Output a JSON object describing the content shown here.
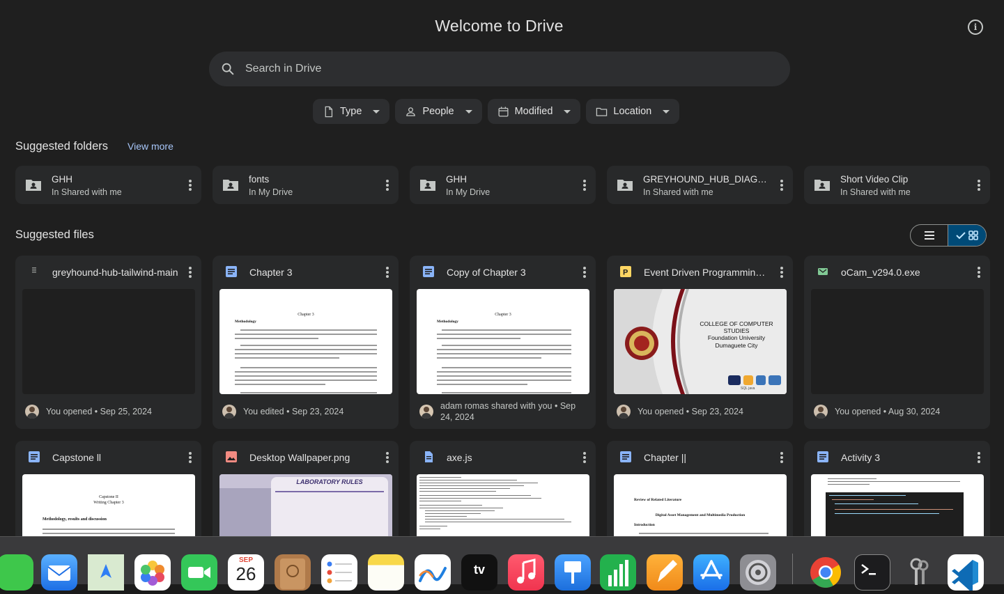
{
  "app": {
    "title": "Welcome to Drive",
    "info_icon": "info-icon"
  },
  "search": {
    "placeholder": "Search in Drive"
  },
  "filters": [
    {
      "label": "Type",
      "icon": "file-icon"
    },
    {
      "label": "People",
      "icon": "person-icon"
    },
    {
      "label": "Modified",
      "icon": "calendar-icon"
    },
    {
      "label": "Location",
      "icon": "folder-icon"
    }
  ],
  "suggested_folders": {
    "heading": "Suggested folders",
    "view_more": "View more",
    "items": [
      {
        "name": "GHH",
        "location": "In Shared with me"
      },
      {
        "name": "fonts",
        "location": "In My Drive"
      },
      {
        "name": "GHH",
        "location": "In My Drive"
      },
      {
        "name": "GREYHOUND_HUB_DIAGRAMS",
        "location": "In Shared with me"
      },
      {
        "name": "Short Video Clip",
        "location": "In Shared with me"
      }
    ]
  },
  "suggested_files": {
    "heading": "Suggested files",
    "items": [
      {
        "name": "greyhound-hub-tailwind-main",
        "activity": "You opened • Sep 25, 2024",
        "icon": "zip-icon",
        "icon_color": "#8e918f"
      },
      {
        "name": "Chapter 3",
        "activity": "You edited • Sep 23, 2024",
        "icon": "docs-icon",
        "icon_color": "#8ab4f8",
        "doc_title": "Chapter 3",
        "doc_sub": "Methodology"
      },
      {
        "name": "Copy of Chapter 3",
        "activity": "adam romas shared with you • Sep 24, 2024",
        "icon": "docs-icon",
        "icon_color": "#8ab4f8",
        "doc_title": "Chapter 3",
        "doc_sub": "Methodology"
      },
      {
        "name": "Event Driven Programming.pptx",
        "activity": "You opened • Sep 23, 2024",
        "icon": "slides-icon",
        "icon_color": "#fdd663",
        "slide_line1": "COLLEGE OF COMPUTER STUDIES",
        "slide_line2": "Foundation University",
        "slide_line3": "Dumaguete City",
        "slide_tags": "SQL java"
      },
      {
        "name": "oCam_v294.0.exe",
        "activity": "You opened • Aug 30, 2024",
        "icon": "exe-icon",
        "icon_color": "#81c995"
      },
      {
        "name": "Capstone ll",
        "icon": "docs-icon",
        "icon_color": "#8ab4f8",
        "doc_title": "Capstone II",
        "doc_sub": "Writing Chapter 3",
        "doc_sub2": "Methodology, results and discussion"
      },
      {
        "name": "Desktop Wallpaper.png",
        "icon": "image-icon",
        "icon_color": "#f28b82",
        "img_text": "LABORATORY RULES"
      },
      {
        "name": "axe.js",
        "icon": "code-file-icon",
        "icon_color": "#8ab4f8"
      },
      {
        "name": "Chapter ||",
        "icon": "docs-icon",
        "icon_color": "#8ab4f8",
        "doc_title": "Review of Related Literature",
        "doc_sub": "Digital Asset Management and Multimedia Production",
        "doc_sub2": "Introduction"
      },
      {
        "name": "Activity 3",
        "icon": "docs-icon",
        "icon_color": "#8ab4f8"
      }
    ]
  },
  "view_toggle": {
    "list_icon": "list-view-icon",
    "grid_icon": "grid-view-icon",
    "selected": "grid"
  },
  "dock": {
    "calendar_month": "SEP",
    "calendar_day": "26",
    "apps": [
      "messages-icon",
      "mail-icon",
      "maps-icon",
      "photos-icon",
      "facetime-icon",
      "calendar-icon",
      "contacts-icon",
      "reminders-icon",
      "notes-icon",
      "freeform-icon",
      "appletv-icon",
      "music-icon",
      "keynote-icon",
      "numbers-icon",
      "pages-icon",
      "appstore-icon",
      "settings-icon",
      "chrome-icon",
      "terminal-icon",
      "keychain-icon",
      "vscode-icon"
    ],
    "tv_label": "tv"
  }
}
